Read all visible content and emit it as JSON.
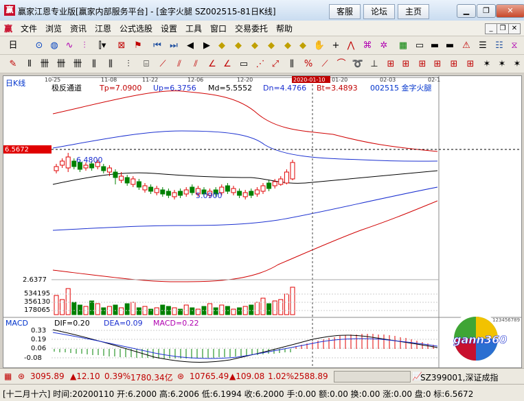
{
  "window": {
    "title": "赢家江恩专业版[赢家内部服务平台] - [金字火腿  SZ002515-81日K线]",
    "icon_char": "赢",
    "buttons": [
      "客服",
      "论坛",
      "主页"
    ]
  },
  "menu": [
    "文件",
    "浏览",
    "资讯",
    "江恩",
    "公式选股",
    "设置",
    "工具",
    "窗口",
    "交易委托",
    "帮助"
  ],
  "chart": {
    "period_label": "日K线",
    "indicator_name": "极反通道",
    "tp": "Tp=7.0900",
    "up": "Up=6.3756",
    "md": "Md=5.5552",
    "dn": "Dn=4.4766",
    "bt": "Bt=3.4893",
    "stock": "002515  金字火腿",
    "dates": [
      "10-25",
      "11-08",
      "11-22",
      "12-06",
      "12-20",
      "2020-01-10",
      "01-20",
      "02-03",
      "02-1"
    ],
    "price_marker": "6.5672",
    "high_label": "6.4800",
    "low_label": "5.0900",
    "price_low_tick": "2.6377",
    "volume_ticks": [
      "534195",
      "356130",
      "178065"
    ],
    "macd": {
      "name": "MACD",
      "dif": "DIF=0.20",
      "dea": "DEA=0.09",
      "macd": "MACD=0.22",
      "ticks": [
        "0.33",
        "0.19",
        "0.06",
        "-0.08"
      ]
    },
    "logo_text": "gann360",
    "logo_ring": "123456789"
  },
  "statusbar": {
    "sh_value": "3095.89",
    "sh_change": "▲12.10",
    "sh_pct": "0.39%",
    "sh_amount": "1780.34亿",
    "sz_value": "10765.49",
    "sz_change": "▲109.08",
    "sz_pct": "1.02%",
    "sz_amount": "2588.89",
    "index_label": "SZ399001,深证成指"
  },
  "infobar": {
    "text": "[十二月十六] 时间:20200110 开:6.2000 高:6.2006 低:6.1994 收:6.2000 手:0.00 额:0.00 换:0.00 涨:0.00 盘:0 标:6.5672"
  },
  "colors": {
    "up_candle": "#e00000",
    "down_candle": "#008000",
    "channel_outer": "#d00000",
    "channel_inner": "#1a2fd0",
    "mid_line": "#000000"
  }
}
